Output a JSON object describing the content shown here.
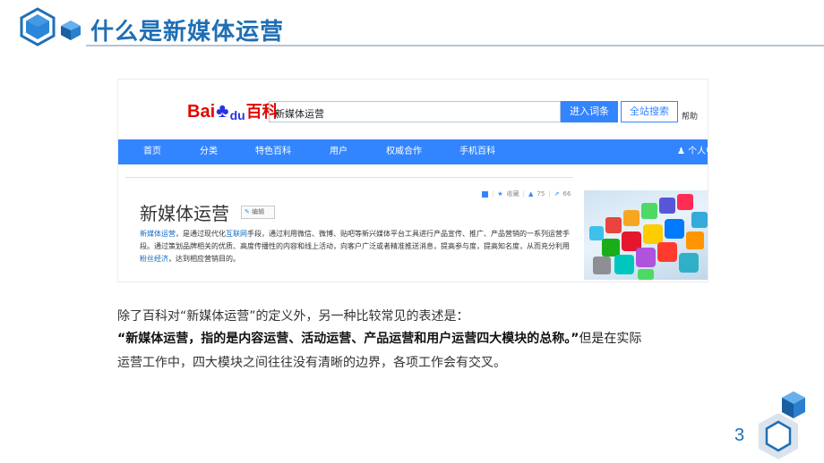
{
  "slide": {
    "title": "什么是新媒体运营",
    "page_number": "3"
  },
  "baike": {
    "logo": {
      "bai": "Bai",
      "du": "du",
      "baike": "百科"
    },
    "search": {
      "value": "新媒体运营",
      "enter_button": "进入词条",
      "all_button": "全站搜索",
      "help": "帮助"
    },
    "nav": {
      "items": [
        "首页",
        "分类",
        "特色百科",
        "用户",
        "权威合作",
        "手机百科"
      ],
      "user": "个人中"
    },
    "entry": {
      "title": "新媒体运营",
      "edit_label": "编辑",
      "toolbar": {
        "collect": "收藏",
        "likes": "75",
        "shares": "66"
      },
      "desc": {
        "term": "新媒体运营",
        "part1": "，是通过现代化",
        "link_internet": "互联网",
        "part2": "手段，通过利用微信、微博、贴吧等新兴媒体平台工具进行产品宣传、推广、产品营销的一系列运营手段。通过策划品牌相关的优质、高度传播性的内容和线上活动，向客户广泛或者精准推送消息，提高参与度，提高知名度，从而充分利用",
        "link_fans": "粉丝经济",
        "part3": "，达到相应营销目的。"
      }
    }
  },
  "text": {
    "line1": "除了百科对“新媒体运营”的定义外，另一种比较常见的表述是：",
    "line2_bold": "“新媒体运营，指的是内容运营、活动运营、产品运营和用户运营四大模块的总称。”",
    "line2_tail": "但是在实际",
    "line3": "运营工作中，四大模块之间往往没有清晰的边界，各项工作会有交叉。"
  },
  "colors": {
    "title_blue": "#1f6fb5",
    "baike_blue": "#3385ff",
    "baidu_red": "#e10601",
    "baidu_paw_blue": "#2932e1",
    "rule_gray": "#b8c4cf"
  },
  "icons": {
    "header_hexagon": "hexagon-icon",
    "header_gem": "hexagon-gem-icon",
    "edit": "pencil-icon",
    "user": "person-icon",
    "collect": "star-icon",
    "like": "thumbs-up-icon",
    "share": "share-icon",
    "add": "plus-square-icon"
  }
}
